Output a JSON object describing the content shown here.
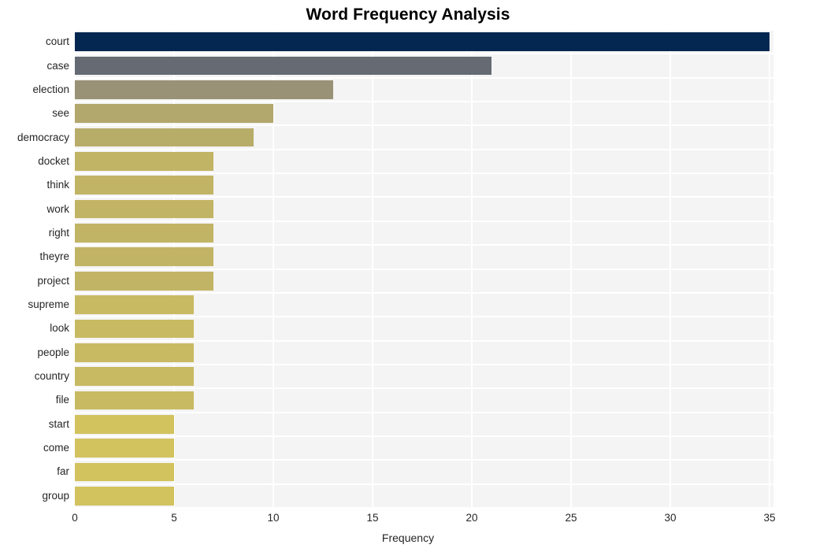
{
  "chart_data": {
    "type": "bar",
    "orientation": "horizontal",
    "title": "Word Frequency Analysis",
    "xlabel": "Frequency",
    "ylabel": "",
    "categories": [
      "court",
      "case",
      "election",
      "see",
      "democracy",
      "docket",
      "think",
      "work",
      "right",
      "theyre",
      "project",
      "supreme",
      "look",
      "people",
      "country",
      "file",
      "start",
      "come",
      "far",
      "group"
    ],
    "values": [
      35,
      21,
      13,
      10,
      9,
      7,
      7,
      7,
      7,
      7,
      7,
      6,
      6,
      6,
      6,
      6,
      5,
      5,
      5,
      5
    ],
    "xlim": [
      0,
      35.2
    ],
    "xticks": [
      0,
      5,
      10,
      15,
      20,
      25,
      30,
      35
    ],
    "xtick_labels": [
      "0",
      "5",
      "10",
      "15",
      "20",
      "25",
      "30",
      "35"
    ],
    "grid": true,
    "legend": "none",
    "bar_colors": [
      "#032750",
      "#656a73",
      "#9a9277",
      "#b2a76c",
      "#b8ac69",
      "#c2b465",
      "#c2b465",
      "#c2b465",
      "#c2b465",
      "#c2b465",
      "#c2b465",
      "#c8ba62",
      "#c8ba62",
      "#c8ba62",
      "#c8ba62",
      "#c8ba62",
      "#d2c35f",
      "#d2c35f",
      "#d2c35f",
      "#d2c35f"
    ],
    "plot_background": "#f4f4f4",
    "gridline_color": "#ffffff",
    "figure_background": "#ffffff",
    "text_color": "#262626"
  }
}
